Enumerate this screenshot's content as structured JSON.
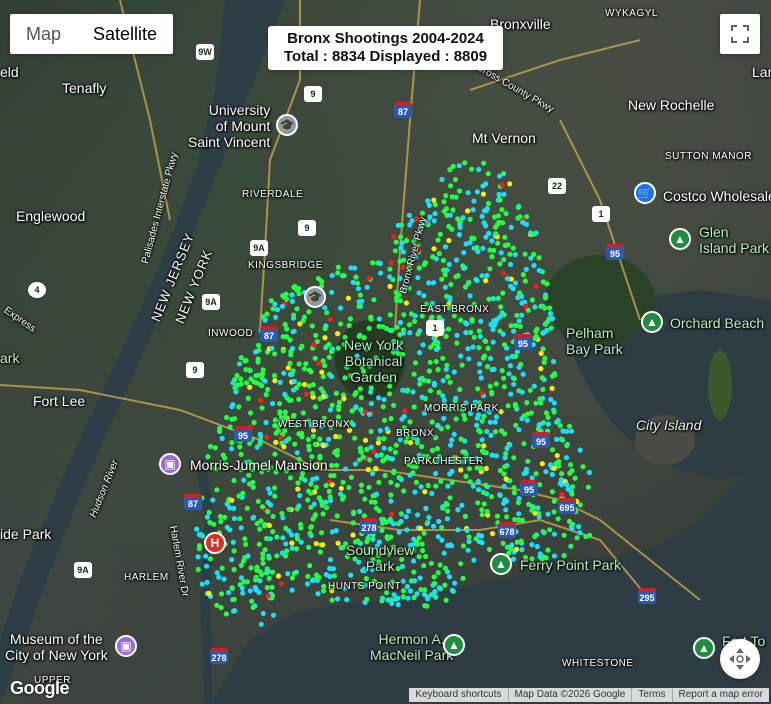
{
  "map_type": {
    "map_label": "Map",
    "satellite_label": "Satellite",
    "selected": "Satellite"
  },
  "title": {
    "line1": "Bronx Shootings 2004-2024",
    "line2": "Total : 8834 Displayed : 8809"
  },
  "icons": {
    "fullscreen": "fullscreen-icon",
    "camera": "camera-control-icon"
  },
  "attribution": {
    "keyboard": "Keyboard shortcuts",
    "data": "Map Data ©2026 Google",
    "terms": "Terms",
    "report": "Report a map error"
  },
  "logo": "Google",
  "labels": {
    "wykagyl": "WYKAGYL",
    "bronxville": "Bronxville",
    "tenafly": "Tenafly",
    "eld": "eld",
    "lar": "Lar",
    "new_rochelle": "New Rochelle",
    "sutton_manor": "SUTTON MANOR",
    "costco": "Costco Wholesale",
    "university": "University\nof Mount\nSaint Vincent",
    "mt_vernon": "Mt Vernon",
    "riverdale": "RIVERDALE",
    "englewood": "Englewood",
    "glen_island": "Glen\nIsland Park",
    "kingsbridge": "KINGSBRIDGE",
    "east_bronx": "EAST BRONX",
    "pelham": "Pelham\nBay Park",
    "orchard": "Orchard Beach",
    "inwood": "INWOOD",
    "nybg": "New York\nBotanical\nGarden",
    "ark": "ark",
    "fort_lee": "Fort Lee",
    "morris_park": "MORRIS PARK",
    "city_island": "City Island",
    "west_bronx": "WEST BRONX",
    "bronx": "BRONX",
    "parkchester": "PARKCHESTER",
    "morris_jumel": "Morris-Jumel Mansion",
    "ide_park": "ide Park",
    "soundview": "Soundview\nPark",
    "ferry_point": "Ferry Point Park",
    "harlem": "HARLEM",
    "hunts_point": "HUNTS POINT",
    "museum": "Museum of the\nCity of New York",
    "hermon": "Hermon A.\nMacNeil Park",
    "whitestone": "WHITESTONE",
    "fort_to": "Fort To",
    "upper": "UPPER",
    "new_jersey": "NEW JERSEY",
    "new_york": "NEW YORK",
    "palisades": "Palisades Interstate Pkwy",
    "hudson": "Hudson River",
    "bronx_river_pkwy": "Bronx River Pkwy",
    "cross_county": "Cross County Pkwy",
    "harlem_river": "Harlem River Dr",
    "express": "Express"
  },
  "shields": [
    "9W",
    "9",
    "87",
    "22",
    "1",
    "95",
    "9A",
    "9",
    "9A",
    "87",
    "1",
    "95",
    "9",
    "95",
    "95",
    "278",
    "87",
    "95",
    "678",
    "695",
    "9A",
    "278",
    "295",
    "4"
  ],
  "colors": {
    "heat_low": "#18e0ff",
    "heat_mid": "#22ff44",
    "heat_high": "#ffee00",
    "heat_max": "#ff1a1a"
  }
}
